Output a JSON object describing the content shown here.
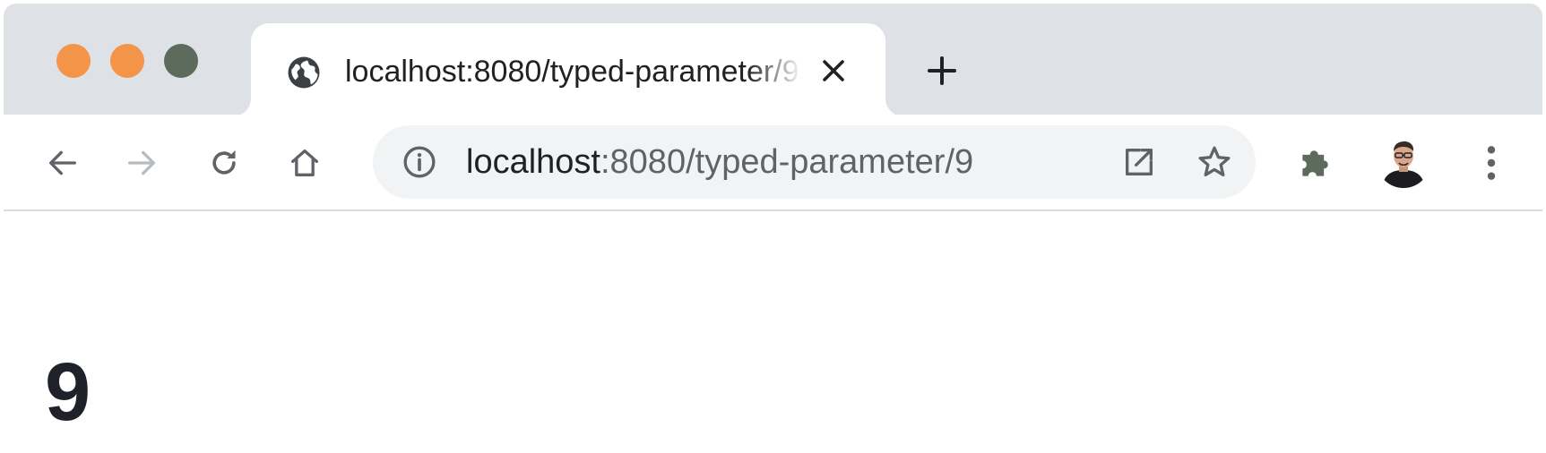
{
  "window": {
    "traffic_lights": {
      "close_color": "#f39449",
      "minimize_color": "#f39449",
      "zoom_color": "#5c6b5c"
    }
  },
  "tab": {
    "title": "localhost:8080/typed-parameter/9",
    "favicon": "globe-icon",
    "close_icon": "close-icon"
  },
  "new_tab_icon": "plus-icon",
  "toolbar": {
    "back_icon": "arrow-left-icon",
    "forward_icon": "arrow-right-icon",
    "reload_icon": "reload-icon",
    "home_icon": "home-icon",
    "site_info_icon": "info-icon",
    "open_external_icon": "open-in-new-icon",
    "bookmark_icon": "star-icon",
    "extensions_icon": "puzzle-piece-icon",
    "profile_icon": "avatar",
    "menu_icon": "three-dots-vertical-icon"
  },
  "address_bar": {
    "host": "localhost",
    "rest": ":8080/typed-parameter/9"
  },
  "colors": {
    "tabstrip_bg": "#dee1e6",
    "omnibox_bg": "#f1f3f4",
    "icon_gray": "#5f6368",
    "icon_disabled": "#b8bcc0"
  },
  "page": {
    "heading": "9"
  }
}
